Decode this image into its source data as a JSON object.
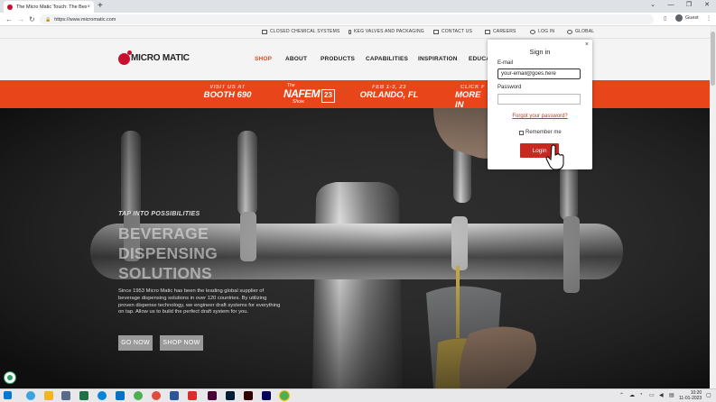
{
  "browser": {
    "tab_title": "The Micro Matic Touch: The Best",
    "tab_close": "×",
    "new_tab": "+",
    "url": "https://www.micromatic.com",
    "profile": "Guest",
    "window_controls": [
      "⌄",
      "—",
      "❐",
      "✕"
    ]
  },
  "utility_nav": [
    "CLOSED CHEMICAL SYSTEMS",
    "KEG VALVES AND PACKAGING",
    "CONTACT US",
    "CAREERS",
    "LOG IN",
    "GLOBAL"
  ],
  "logo": "MICRO MATIC",
  "main_nav": [
    "SHOP",
    "ABOUT",
    "PRODUCTS",
    "CAPABILITIES",
    "INSPIRATION",
    "EDUCA"
  ],
  "banner": {
    "visit_small": "VISIT US AT",
    "visit_big": "BOOTH 690",
    "nafem_the": "The",
    "nafem_name": "NAFEM",
    "nafem_show": "Show.",
    "nafem_year": "23",
    "dates_small": "FEB 1-3, 23",
    "dates_big": "ORLANDO, FL",
    "click_small": "CLICK F",
    "click_big": "MORE IN"
  },
  "hero": {
    "kicker": "TAP INTO POSSIBILITIES",
    "title_lines": [
      "BEVERAGE",
      "DISPENSING",
      "SOLUTIONS"
    ],
    "description": "Since 1953 Micro Matic has been the leading global supplier of beverage dispensing solutions in over 120 countries. By utilizing proven dispense technology, we engineer draft systems for everything on tap. Allow us to build the perfect draft system for you.",
    "btn_go": "GO NOW",
    "btn_shop": "SHOP NOW"
  },
  "signin": {
    "title": "Sign in",
    "close": "×",
    "email_label": "E-mail",
    "email_value": "your-email@goes.here",
    "password_label": "Password",
    "password_value": "",
    "forgot": "Forgot your password?",
    "remember": "Remember me",
    "login": "Login"
  },
  "taskbar": {
    "time": "10:20",
    "date": "11-01-2023"
  },
  "colors": {
    "brand_red": "#c8102e",
    "banner_orange": "#e8461a",
    "login_red": "#c8281e"
  }
}
